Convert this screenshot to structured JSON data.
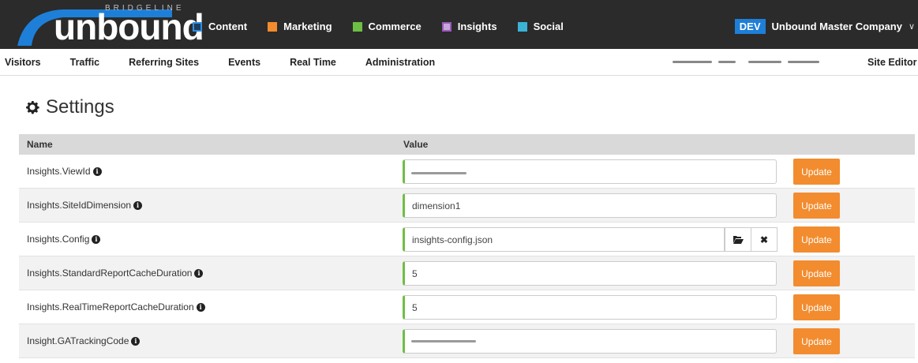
{
  "brand": {
    "name": "unbound",
    "sub": "BRIDGELINE"
  },
  "main_nav": [
    {
      "label": "Content",
      "color": "#2f8fe0"
    },
    {
      "label": "Marketing",
      "color": "#f28c2f"
    },
    {
      "label": "Commerce",
      "color": "#6fbe44"
    },
    {
      "label": "Insights",
      "color": "#9b59b6"
    },
    {
      "label": "Social",
      "color": "#3bb3d4"
    }
  ],
  "company": {
    "badge": "DEV",
    "name": "Unbound Master Company",
    "chevron": "chevron-down-icon"
  },
  "sub_nav": {
    "links": [
      "Visitors",
      "Traffic",
      "Referring Sites",
      "Events",
      "Real Time",
      "Administration"
    ],
    "site_editor": "Site Editor"
  },
  "page": {
    "title": "Settings",
    "icon": "gear-icon"
  },
  "table": {
    "headers": {
      "name": "Name",
      "value": "Value"
    },
    "update_label": "Update",
    "rows": [
      {
        "name": "Insights.ViewId",
        "value": ""
      },
      {
        "name": "Insights.SiteIdDimension",
        "value": "dimension1"
      },
      {
        "name": "Insights.Config",
        "value": "insights-config.json"
      },
      {
        "name": "Insights.StandardReportCacheDuration",
        "value": "5"
      },
      {
        "name": "Insights.RealTimeReportCacheDuration",
        "value": "5"
      },
      {
        "name": "Insight.GATrackingCode",
        "value": ""
      }
    ]
  },
  "colors": {
    "accent_update": "#f28c2f",
    "input_valid": "#6fbe44",
    "topbar": "#2b2b2b",
    "dev_badge": "#1e7fd8"
  }
}
